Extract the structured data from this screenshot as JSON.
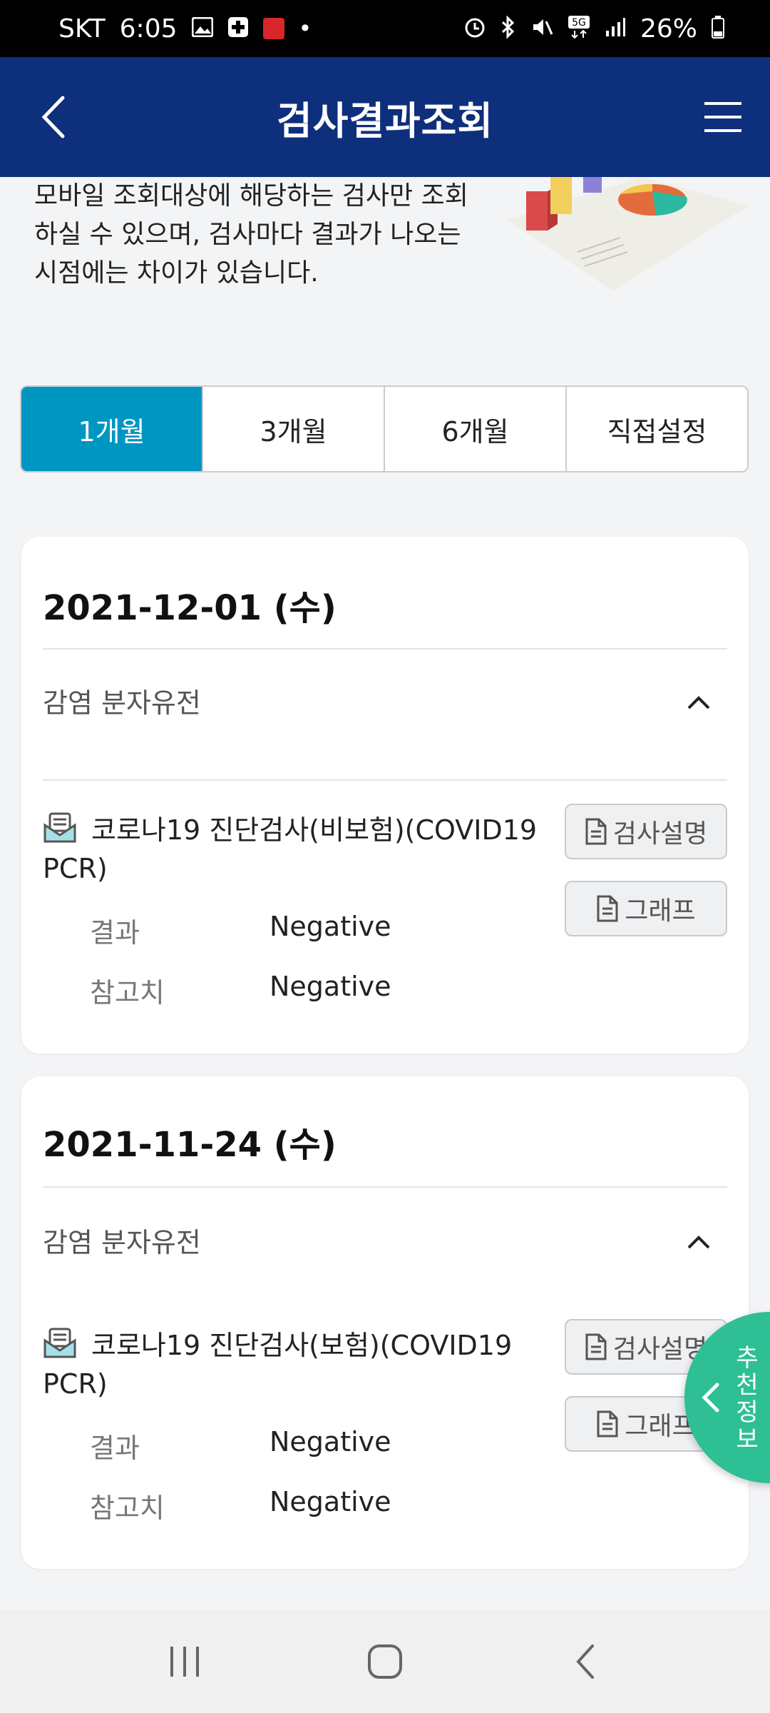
{
  "status_bar": {
    "carrier": "SKT",
    "time": "6:05",
    "battery": "26%",
    "icons_left": [
      "gallery-icon",
      "medical-app-icon",
      "app-notification-icon",
      "dot-icon"
    ],
    "icons_right": [
      "alarm-icon",
      "bluetooth-icon",
      "mute-icon",
      "5g-icon",
      "signal-icon",
      "battery-icon"
    ]
  },
  "header": {
    "title": "검사결과조회"
  },
  "intro": {
    "text": "모바일 조회대상에 해당하는 검사만 조회하실 수 있으며, 검사마다 결과가 나오는 시점에는 차이가 있습니다."
  },
  "period_tabs": [
    {
      "label": "1개월",
      "active": true
    },
    {
      "label": "3개월",
      "active": false
    },
    {
      "label": "6개월",
      "active": false
    },
    {
      "label": "직접설정",
      "active": false
    }
  ],
  "records": [
    {
      "date": "2021-12-01 (수)",
      "category": "감염 분자유전",
      "test_name": "코로나19 진단검사(비보험)(COVID19 PCR)",
      "result_label": "결과",
      "result_value": "Negative",
      "reference_label": "참고치",
      "reference_value": "Negative",
      "explain_button": "검사설명",
      "graph_button": "그래프"
    },
    {
      "date": "2021-11-24 (수)",
      "category": "감염 분자유전",
      "test_name": "코로나19 진단검사(보험)(COVID19 PCR)",
      "result_label": "결과",
      "result_value": "Negative",
      "reference_label": "참고치",
      "reference_value": "Negative",
      "explain_button": "검사설명",
      "graph_button": "그래프"
    }
  ],
  "recommend_button": {
    "label": "추천정보"
  },
  "colors": {
    "header_bg": "#0e2f7c",
    "active_tab": "#0096c2",
    "fab_bg": "#2fbf95"
  }
}
